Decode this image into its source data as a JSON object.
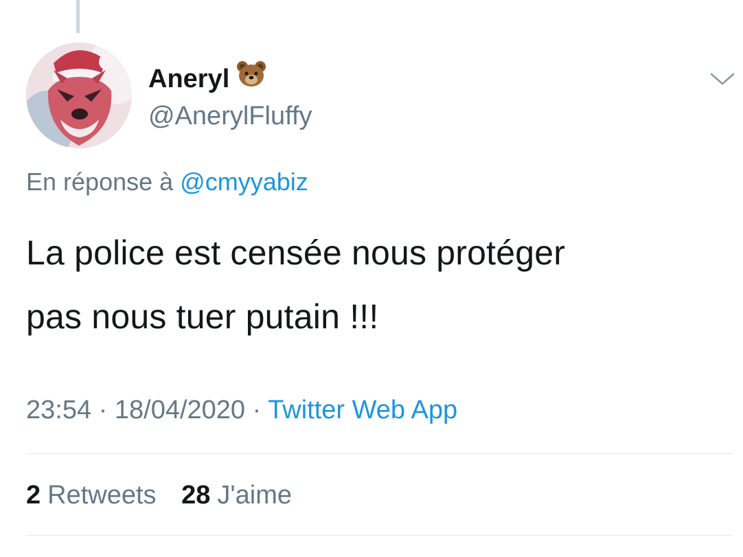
{
  "tweet": {
    "author": {
      "display_name": "Aneryl",
      "name_emoji": "bear-face-emoji",
      "handle": "@AnerylFluffy",
      "avatar": "red-wolf-santa-hat-avatar"
    },
    "reply_context": {
      "prefix": "En réponse à",
      "mention": "@cmyyabiz"
    },
    "text_lines": [
      "La police est censée nous protéger",
      "pas nous tuer putain !!!"
    ],
    "meta": {
      "time": "23:54",
      "separator": "·",
      "date": "18/04/2020",
      "source": "Twitter Web App"
    },
    "stats": {
      "retweets_count": "2",
      "retweets_label": "Retweets",
      "likes_count": "28",
      "likes_label": "J'aime"
    }
  },
  "colors": {
    "text_primary": "#14171a",
    "text_secondary": "#657786",
    "link_blue": "#1b95e0",
    "divider": "#e1e8ed"
  }
}
